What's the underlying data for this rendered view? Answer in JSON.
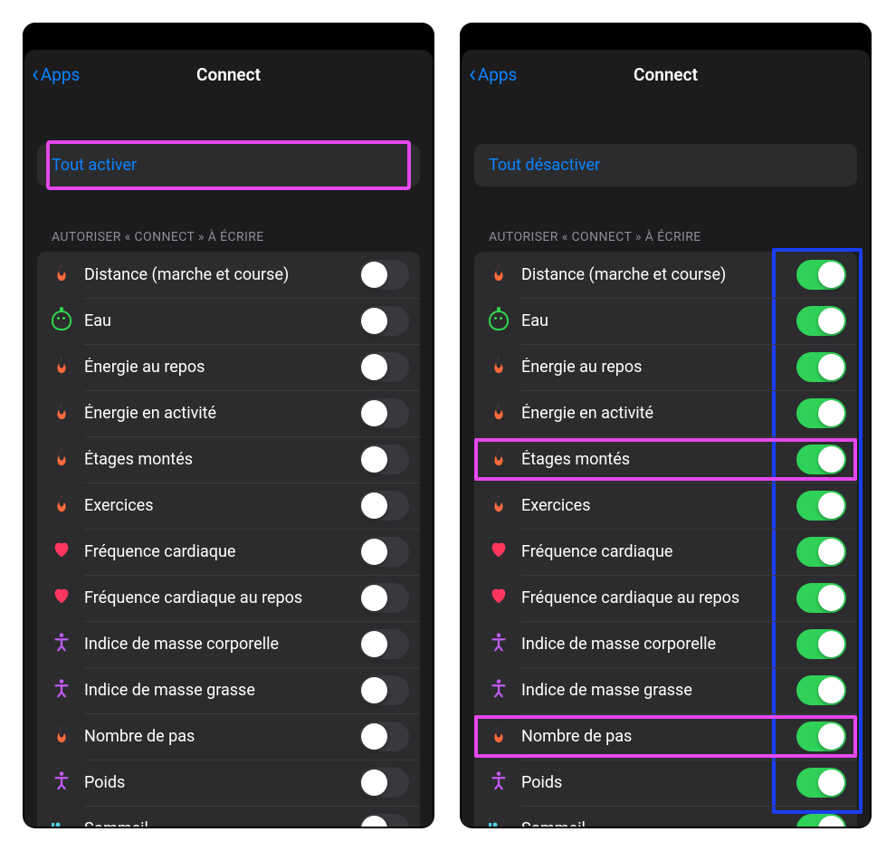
{
  "nav": {
    "back_label": "Apps",
    "title": "Connect"
  },
  "bulk": {
    "enable_all": "Tout activer",
    "disable_all": "Tout désactiver"
  },
  "section_header": "AUTORISER « CONNECT » À ÉCRIRE",
  "items": {
    "distance": "Distance (marche et course)",
    "water": "Eau",
    "rest_energy": "Énergie au repos",
    "active_energy": "Énergie en activité",
    "flights": "Étages montés",
    "exercise": "Exercices",
    "hr": "Fréquence cardiaque",
    "rest_hr": "Fréquence cardiaque au repos",
    "bmi": "Indice de masse corporelle",
    "fat": "Indice de masse grasse",
    "steps": "Nombre de pas",
    "weight": "Poids",
    "sleep": "Sommeil"
  },
  "icons": {
    "flame": "🔥",
    "heart": "♥",
    "body": "🧘",
    "sleep": "🛏"
  },
  "highlights": {
    "left": {
      "bulk_pink": true
    },
    "right": {
      "blue_toggles": true,
      "pink_rows": [
        "flights",
        "steps"
      ]
    }
  }
}
